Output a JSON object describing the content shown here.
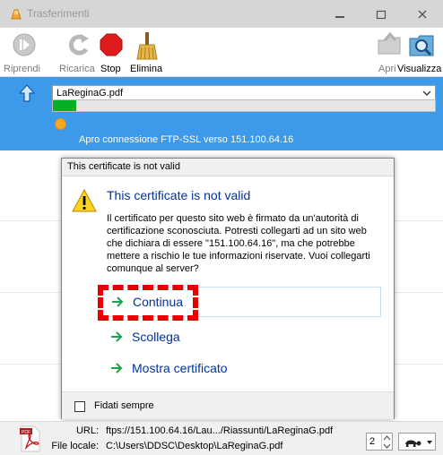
{
  "window": {
    "title": "Trasferimenti"
  },
  "toolbar": {
    "resume": "Riprendi",
    "reload": "Ricarica",
    "stop": "Stop",
    "delete": "Elimina",
    "open": "Apri",
    "view": "Visualizza"
  },
  "transfer": {
    "file": "LaReginaG.pdf",
    "progress_fraction": 0.06,
    "status": "Apro connessione FTP-SSL verso 151.100.64.16"
  },
  "dialog": {
    "window_title": "This certificate is not valid",
    "heading": "This certificate is not valid",
    "body": "Il certificato per questo sito web è firmato da un'autorità di certificazione sconosciuta. Potresti collegarti ad un sito web che dichiara di essere \"151.100.64.16\", ma che potrebbe mettere a rischio le tue informazioni riservate. Vuoi collegarti comunque al server?",
    "continue": "Continua",
    "disconnect": "Scollega",
    "show_cert": "Mostra certificato",
    "always_trust": "Fidati sempre"
  },
  "footer": {
    "url_label": "URL:",
    "url_value": "ftps://151.100.64.16/Lau.../Riassunti/LaReginaG.pdf",
    "local_label": "File locale:",
    "local_value": "C:\\Users\\DDSC\\Desktop\\LaReginaG.pdf",
    "connections": "2"
  },
  "colors": {
    "selection": "#3d99ea",
    "progress": "#06b025",
    "link": "#003399",
    "annotation": "#e60000"
  }
}
